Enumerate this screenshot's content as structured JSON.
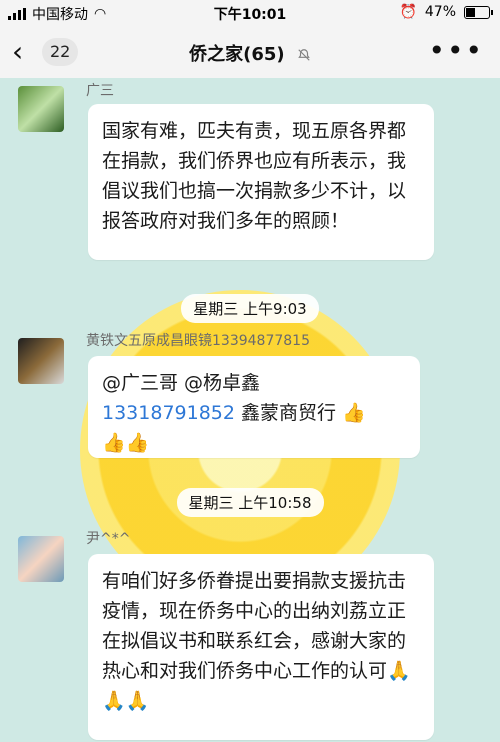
{
  "status_bar": {
    "carrier": "中国移动",
    "time": "下午10:01",
    "battery": "47%"
  },
  "nav": {
    "back_count": "22",
    "title": "侨之家(65)",
    "more_icon": "more-horizontal-icon"
  },
  "messages": [
    {
      "sender": "广三",
      "text": "国家有难，匹夫有责，现五原各界都在捐款，我们侨界也应有所表示，我倡议我们也搞一次捐款多少不计，以报答政府对我们多年的照顾！"
    },
    {
      "time": "星期三 上午9:03"
    },
    {
      "sender": "黄铁文五原成昌眼镜13394877815",
      "parts": [
        "@广三哥 @杨卓鑫",
        "13318791852",
        " 鑫蒙商贸行 ",
        "👍",
        "👍👍"
      ]
    },
    {
      "time": "星期三 上午10:58"
    },
    {
      "sender": "尹^*^",
      "text": "有咱们好多侨眷提出要捐款支援抗击疫情，现在侨务中心的出纳刘荔立正在拟倡议书和联系红会，感谢大家的热心和对我们侨务中心工作的认可🙏",
      "emoji_tail": "🙏🙏"
    }
  ]
}
